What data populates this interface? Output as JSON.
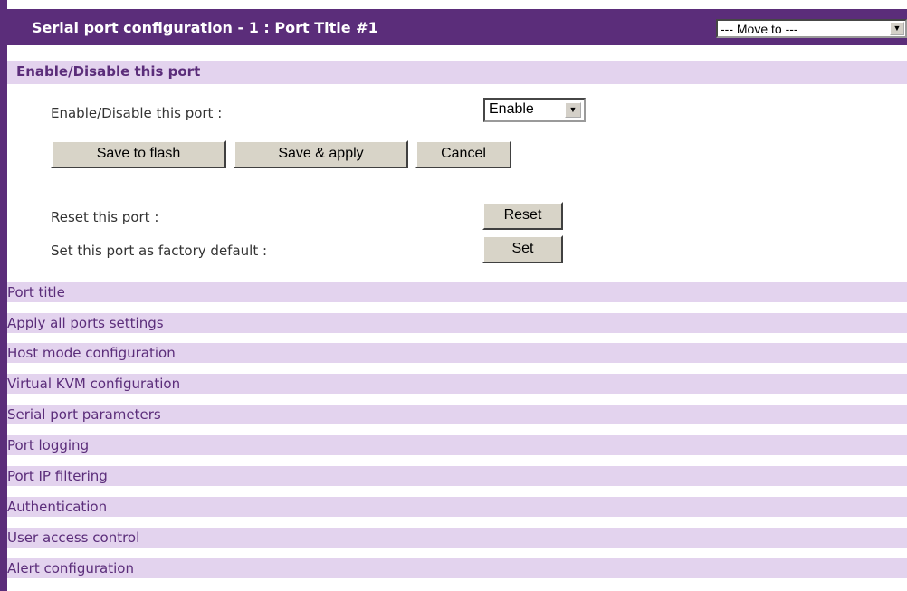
{
  "header": {
    "title": "Serial port configuration - 1 : Port Title #1",
    "move_to": "--- Move to ---"
  },
  "enable_section": {
    "title": "Enable/Disable this port",
    "field_label": "Enable/Disable this port :",
    "field_value": "Enable",
    "buttons": {
      "save_flash": "Save to flash",
      "save_apply": "Save & apply",
      "cancel": "Cancel"
    }
  },
  "reset_section": {
    "reset_label": "Reset this port :",
    "reset_button": "Reset",
    "factory_label": "Set this port as factory default :",
    "factory_button": "Set"
  },
  "menu": [
    "Port title",
    "Apply all ports settings",
    "Host mode configuration",
    "Virtual KVM configuration",
    "Serial port parameters",
    "Port logging",
    "Port IP filtering",
    "Authentication",
    "User access control",
    "Alert configuration"
  ],
  "colors": {
    "header": "#5b2d7a",
    "section": "#e3d3ee",
    "link_text": "#5b2d7a"
  }
}
